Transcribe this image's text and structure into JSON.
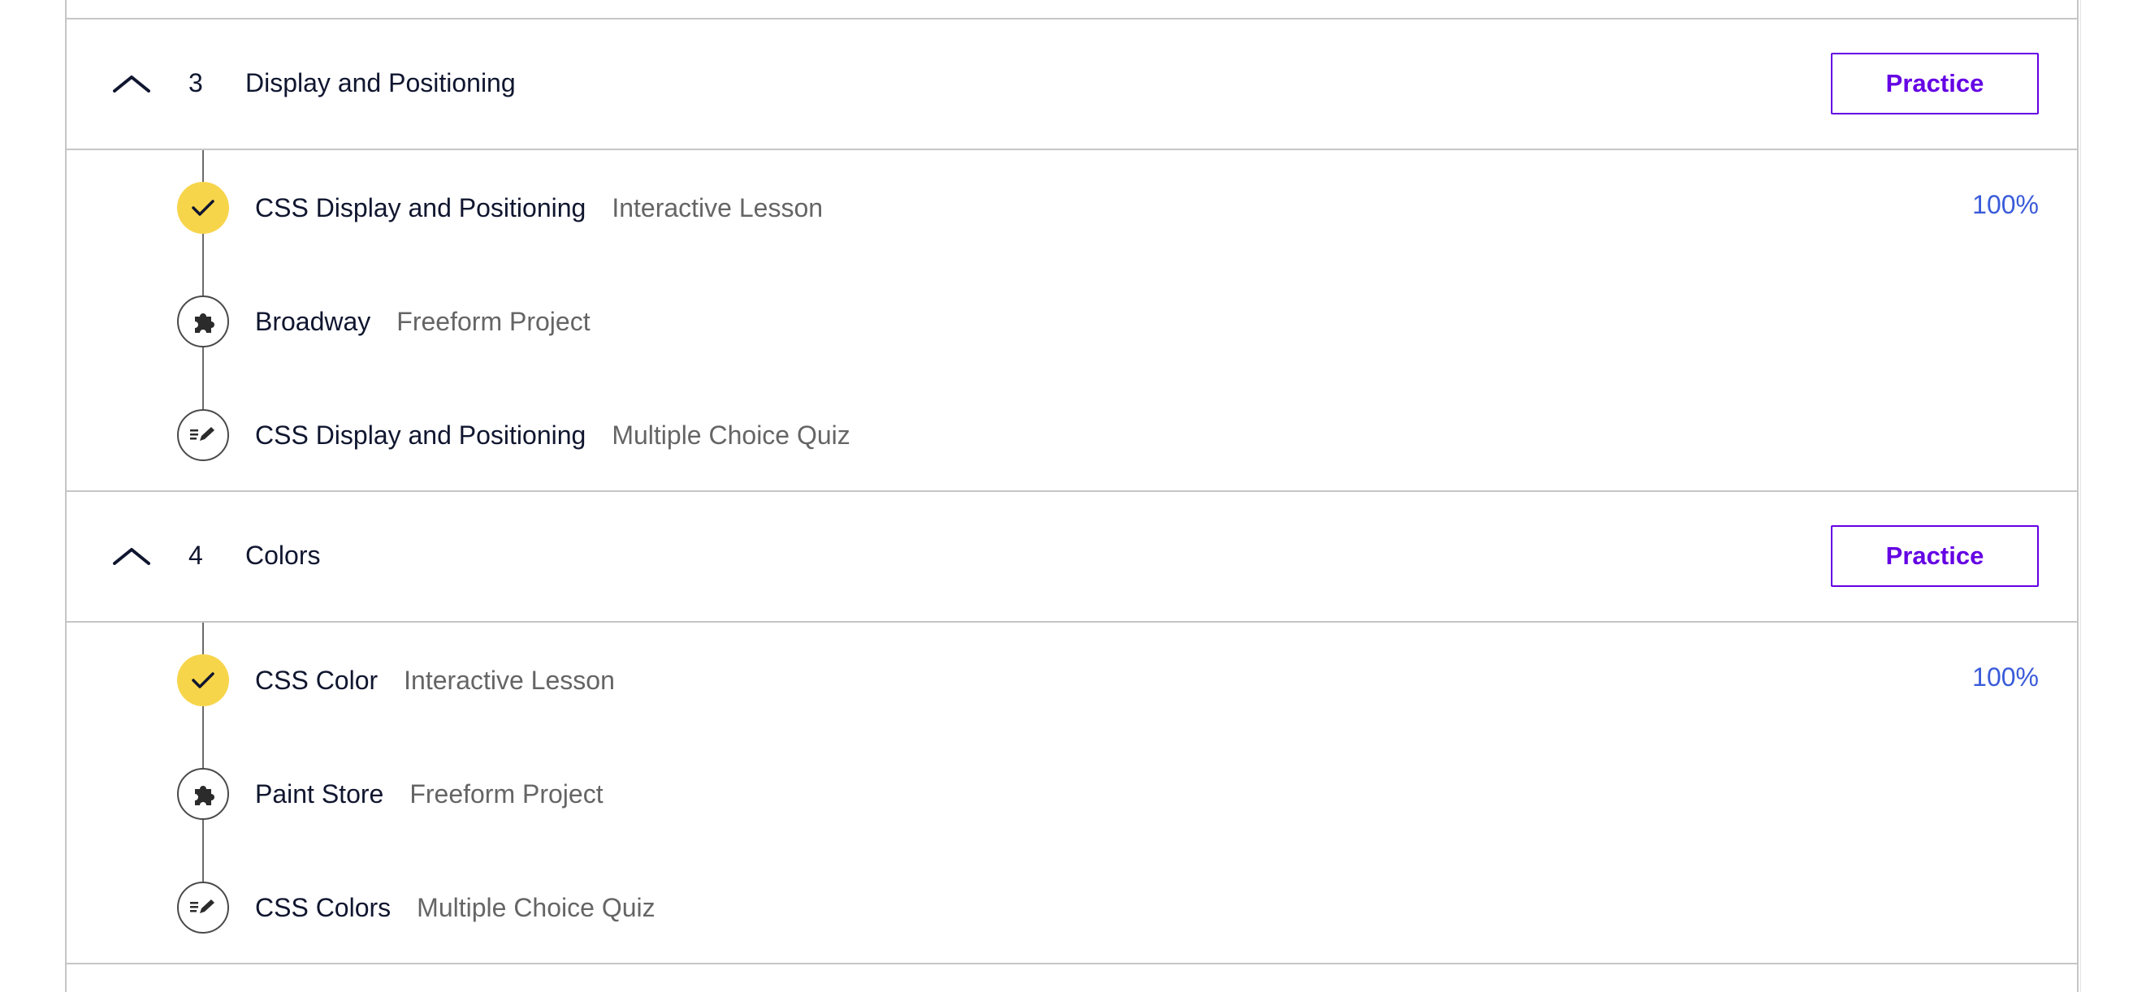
{
  "modules": [
    {
      "number": "3",
      "title": "Display and Positioning",
      "practice_label": "Practice",
      "items": [
        {
          "title": "CSS Display and Positioning",
          "type": "Interactive Lesson",
          "status": "complete",
          "progress": "100%",
          "icon": "check-icon"
        },
        {
          "title": "Broadway",
          "type": "Freeform Project",
          "status": "not-started",
          "progress": "",
          "icon": "puzzle-icon"
        },
        {
          "title": "CSS Display and Positioning",
          "type": "Multiple Choice Quiz",
          "status": "not-started",
          "progress": "",
          "icon": "quiz-icon"
        }
      ]
    },
    {
      "number": "4",
      "title": "Colors",
      "practice_label": "Practice",
      "items": [
        {
          "title": "CSS Color",
          "type": "Interactive Lesson",
          "status": "complete",
          "progress": "100%",
          "icon": "check-icon"
        },
        {
          "title": "Paint Store",
          "type": "Freeform Project",
          "status": "not-started",
          "progress": "",
          "icon": "puzzle-icon"
        },
        {
          "title": "CSS Colors",
          "type": "Multiple Choice Quiz",
          "status": "not-started",
          "progress": "",
          "icon": "quiz-icon"
        }
      ]
    }
  ],
  "colors": {
    "accent": "#6400e4",
    "complete": "#f7d54b",
    "progress_text": "#3a5bd9",
    "secondary_text": "#656565"
  }
}
